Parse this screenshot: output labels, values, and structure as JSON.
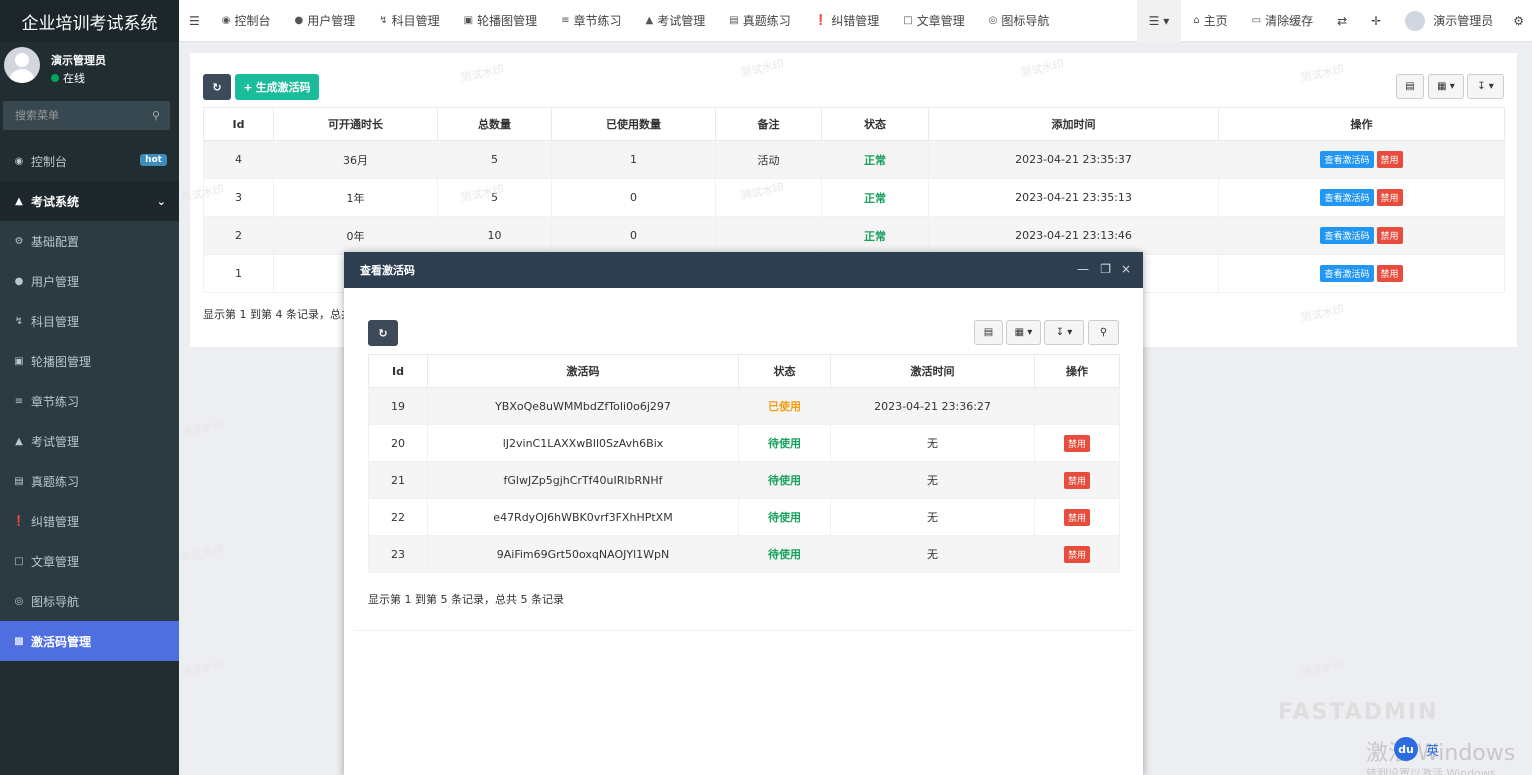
{
  "app": {
    "title": "企业培训考试系统"
  },
  "user": {
    "name": "演示管理员",
    "status": "在线"
  },
  "sidebar": {
    "search_placeholder": "搜索菜单",
    "dashboard": {
      "label": "控制台",
      "badge": "hot"
    },
    "group": {
      "label": "考试系统"
    },
    "items": [
      {
        "label": "基础配置",
        "icon": "gear-icon"
      },
      {
        "label": "用户管理",
        "icon": "user-icon"
      },
      {
        "label": "科目管理",
        "icon": "bolt-icon"
      },
      {
        "label": "轮播图管理",
        "icon": "image-icon"
      },
      {
        "label": "章节练习",
        "icon": "list-icon"
      },
      {
        "label": "考试管理",
        "icon": "graduation-cap-icon"
      },
      {
        "label": "真题练习",
        "icon": "newspaper-icon"
      },
      {
        "label": "纠错管理",
        "icon": "exclamation-circle-icon"
      },
      {
        "label": "文章管理",
        "icon": "file-text-icon"
      },
      {
        "label": "图标导航",
        "icon": "compass-icon"
      },
      {
        "label": "激活码管理",
        "icon": "ticket-icon",
        "active": true
      }
    ]
  },
  "topnav": {
    "items": [
      "控制台",
      "用户管理",
      "科目管理",
      "轮播图管理",
      "章节练习",
      "考试管理",
      "真题练习",
      "纠错管理",
      "文章管理",
      "图标导航"
    ],
    "home": "主页",
    "clear_cache": "清除缓存",
    "admin": "演示管理员"
  },
  "toolbar": {
    "generate": "生成激活码"
  },
  "main_table": {
    "headers": [
      "Id",
      "可开通时长",
      "总数量",
      "已使用数量",
      "备注",
      "状态",
      "添加时间",
      "操作"
    ],
    "rows": [
      {
        "id": "4",
        "duration": "36月",
        "total": "5",
        "used": "1",
        "remark": "活动",
        "status": "正常",
        "time": "2023-04-21 23:35:37"
      },
      {
        "id": "3",
        "duration": "1年",
        "total": "5",
        "used": "0",
        "remark": "",
        "status": "正常",
        "time": "2023-04-21 23:35:13"
      },
      {
        "id": "2",
        "duration": "0年",
        "total": "10",
        "used": "0",
        "remark": "",
        "status": "正常",
        "time": "2023-04-21 23:13:46"
      },
      {
        "id": "1",
        "duration": "",
        "total": "",
        "used": "",
        "remark": "",
        "status": "",
        "time": ""
      }
    ],
    "action_view": "查看激活码",
    "action_disable": "禁用",
    "pager": "显示第 1 到第 4 条记录，总共"
  },
  "modal": {
    "title": "查看激活码",
    "headers": [
      "Id",
      "激活码",
      "状态",
      "激活时间",
      "操作"
    ],
    "rows": [
      {
        "id": "19",
        "code": "YBXoQe8uWMMbdZfToIi0o6j297",
        "status": "已使用",
        "time": "2023-04-21 23:36:27",
        "action": ""
      },
      {
        "id": "20",
        "code": "lJ2vinC1LAXXwBIl0SzAvh6Bix",
        "status": "待使用",
        "time": "无",
        "action": "禁用"
      },
      {
        "id": "21",
        "code": "fGlwJZp5gjhCrTf40uIRlbRNHf",
        "status": "待使用",
        "time": "无",
        "action": "禁用"
      },
      {
        "id": "22",
        "code": "e47RdyOJ6hWBK0vrf3FXhHPtXM",
        "status": "待使用",
        "time": "无",
        "action": "禁用"
      },
      {
        "id": "23",
        "code": "9AiFim69Grt50oxqNAOJYl1WpN",
        "status": "待使用",
        "time": "无",
        "action": "禁用"
      }
    ],
    "pager": "显示第 1 到第 5 条记录，总共 5 条记录"
  },
  "watermark": "测试水印",
  "os": {
    "activate": "激活 Windows",
    "activate_sub": "转到设置以激活 Windows",
    "ime": "英"
  },
  "colors": {
    "sidebar_bg": "#222d32",
    "active": "#4f6fe1",
    "green": "#1abc9c",
    "modal_head": "#2c3e50",
    "ok": "#18a15c",
    "used": "#f39c12",
    "danger": "#e74c3c"
  }
}
